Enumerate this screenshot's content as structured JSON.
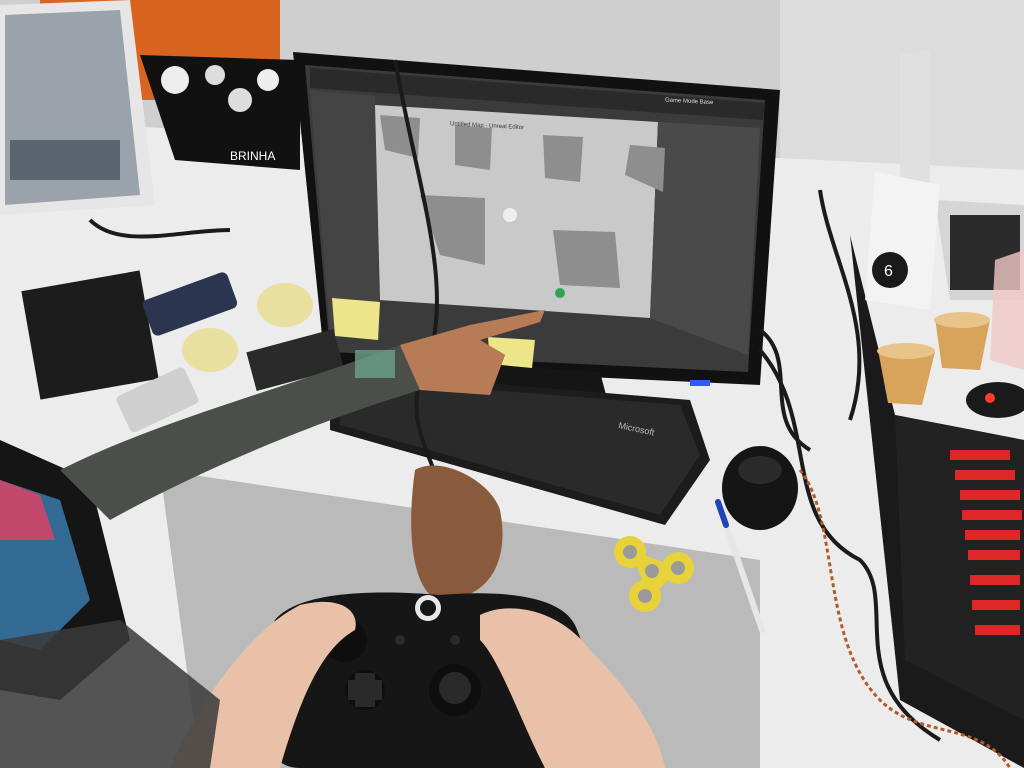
{
  "scene": {
    "keyboard_brand": "Microsoft",
    "laptop_sticker_text": "BRINHA",
    "badge_number": "6",
    "monitor_titlebar_text": "Game Mode Base",
    "viewport_title_text": "Untitled Map - Unreal Editor"
  },
  "colors": {
    "wall": "#d2d2d2",
    "desk": "#ececec",
    "monitor_bezel": "#111111",
    "editor_bg": "#3b3b3b",
    "viewport_floor": "#c9c9c9",
    "controller": "#161616",
    "spinner": "#e8d23a",
    "keyboard_led": "#ff2a2a",
    "blue_led": "#2d5bff",
    "orange_panel": "#d9641f"
  },
  "icons": [
    "xbox-controller-icon",
    "fidget-spinner-icon",
    "computer-mouse-icon",
    "pen-icon",
    "paper-cup-icon",
    "sticky-note-icon"
  ]
}
